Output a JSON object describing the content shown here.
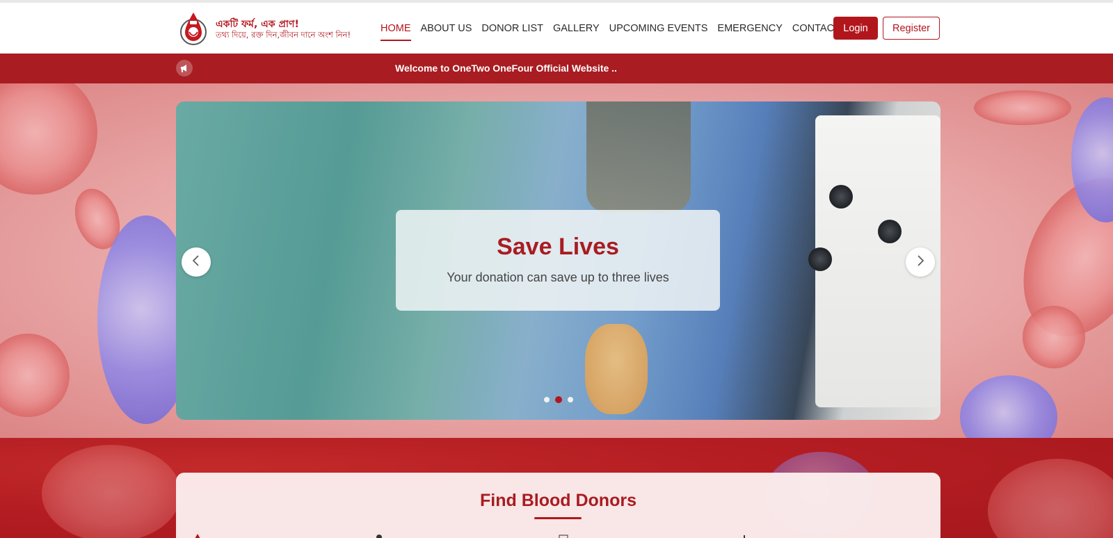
{
  "brand": {
    "title": "একটি ফর্ম, এক প্রাণ!",
    "subtitle": "তথ্য দিয়ে, রক্ত দিন,জীবন দানে অংশ নিন!"
  },
  "nav": {
    "items": [
      {
        "label": "HOME",
        "active": true
      },
      {
        "label": "ABOUT US"
      },
      {
        "label": "DONOR LIST"
      },
      {
        "label": "GALLERY"
      },
      {
        "label": "UPCOMING EVENTS"
      },
      {
        "label": "EMERGENCY"
      },
      {
        "label": "CONTACT"
      }
    ],
    "login_label": "Login",
    "register_label": "Register"
  },
  "announcement": {
    "icon": "megaphone-icon",
    "text": "Welcome to OneTwo OneFour Official Website .."
  },
  "carousel": {
    "caption_title": "Save Lives",
    "caption_subtitle": "Your donation can save up to three lives",
    "active_index": 1,
    "slide_count": 3
  },
  "find_donors": {
    "title": "Find Blood Donors"
  },
  "colors": {
    "brand": "#b2161d",
    "announce_bg": "#a81c22"
  }
}
